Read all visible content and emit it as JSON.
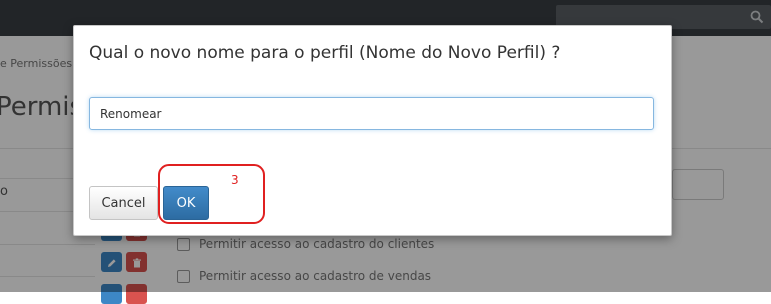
{
  "page": {
    "breadcrumb": "e Permissões",
    "title": "Permiss",
    "table_first_cell": "o",
    "permissions": [
      {
        "label": "Permitir acesso ao cadastro do clientes",
        "checked": false
      },
      {
        "label": "Permitir acesso ao cadastro de vendas",
        "checked": false
      }
    ]
  },
  "icons": {
    "search": "search-icon",
    "edit": "pencil-icon",
    "delete": "trash-icon"
  },
  "dialog": {
    "title": "Qual o novo nome para o perfil (Nome do Novo Perfil) ?",
    "input_value": "Renomear",
    "cancel_label": "Cancel",
    "ok_label": "OK"
  },
  "annotation": {
    "step": "3",
    "color": "#e02020"
  },
  "colors": {
    "primary": "#428bca",
    "danger": "#d9534f",
    "topbar": "#3a3f44"
  }
}
